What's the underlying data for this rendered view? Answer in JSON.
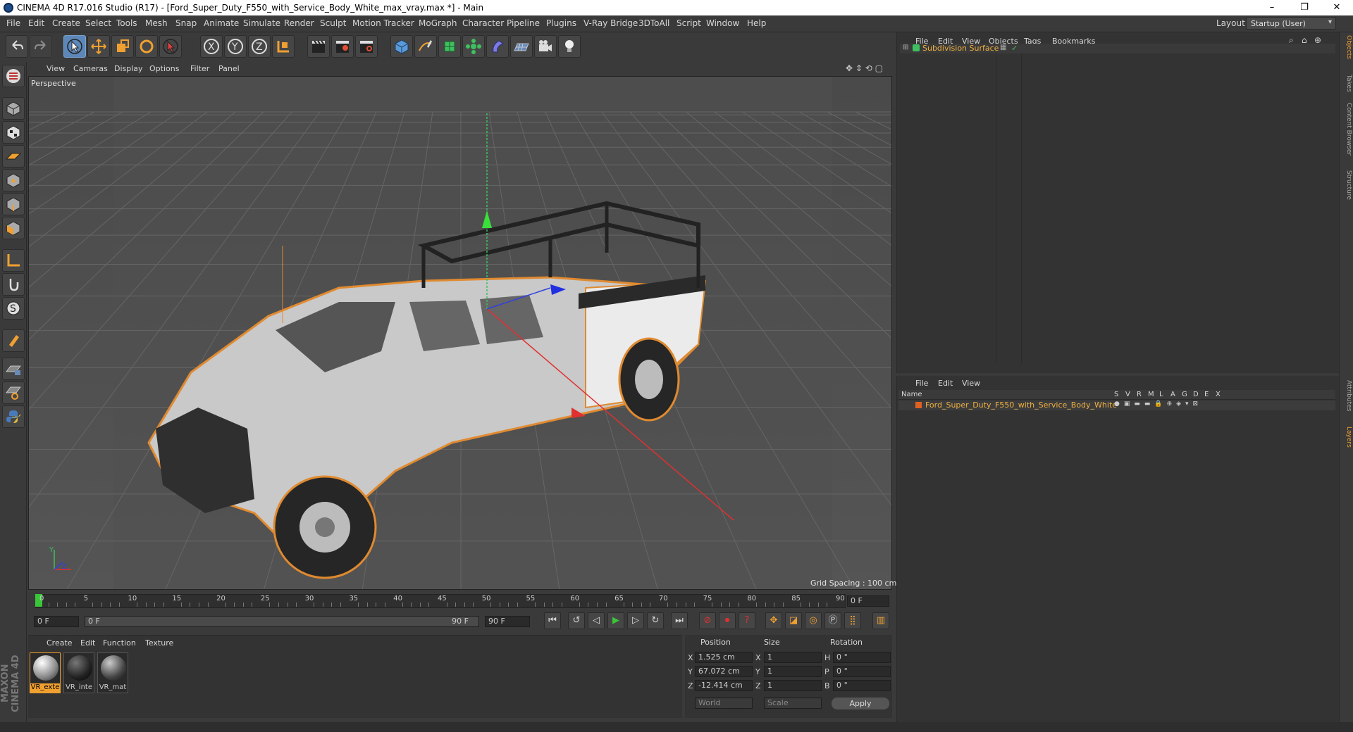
{
  "window": {
    "title": "CINEMA 4D R17.016 Studio (R17) - [Ford_Super_Duty_F550_with_Service_Body_White_max_vray.max *] - Main",
    "minimize": "–",
    "restore": "❐",
    "close": "✕"
  },
  "menubar": {
    "items": [
      "File",
      "Edit",
      "Create",
      "Select",
      "Tools",
      "Mesh",
      "Snap",
      "Animate",
      "Simulate",
      "Render",
      "Sculpt",
      "Motion Tracker",
      "MoGraph",
      "Character",
      "Pipeline",
      "Plugins",
      "V-Ray Bridge",
      "3DToAll",
      "Script",
      "Window",
      "Help"
    ],
    "layout_label": "Layout:",
    "layout_value": "Startup (User)"
  },
  "viewport": {
    "menu": [
      "View",
      "Cameras",
      "Display",
      "Options",
      "Filter",
      "Panel"
    ],
    "camera_label": "Perspective",
    "grid_spacing": "Grid Spacing : 100 cm",
    "axis_y": "Y",
    "axis_z": "Z"
  },
  "timeline": {
    "ticks": [
      "0",
      "5",
      "10",
      "15",
      "20",
      "25",
      "30",
      "35",
      "40",
      "45",
      "50",
      "55",
      "60",
      "65",
      "70",
      "75",
      "80",
      "85",
      "90"
    ],
    "frame_end_field": "0 F",
    "current_frame": "0 F",
    "range_start": "0 F",
    "range_end_inner": "90 F",
    "range_end": "90 F"
  },
  "materials": {
    "menu": [
      "Create",
      "Edit",
      "Function",
      "Texture"
    ],
    "items": [
      "VR_exte",
      "VR_inte",
      "VR_mat"
    ]
  },
  "coords": {
    "headers": [
      "Position",
      "Size",
      "Rotation"
    ],
    "rows": [
      {
        "axis": "X",
        "pos": "1.525 cm",
        "saxis": "X",
        "size": "1",
        "raxis": "H",
        "rot": "0 °"
      },
      {
        "axis": "Y",
        "pos": "67.072 cm",
        "saxis": "Y",
        "size": "1",
        "raxis": "P",
        "rot": "0 °"
      },
      {
        "axis": "Z",
        "pos": "-12.414 cm",
        "saxis": "Z",
        "size": "1",
        "raxis": "B",
        "rot": "0 °"
      }
    ],
    "mode": "World",
    "scale": "Scale",
    "apply": "Apply"
  },
  "objects": {
    "menu": [
      "File",
      "Edit",
      "View",
      "Objects",
      "Tags",
      "Bookmarks"
    ],
    "item": "Subdivision Surface"
  },
  "layers": {
    "menu": [
      "File",
      "Edit",
      "View"
    ],
    "name_header": "Name",
    "columns": [
      "S",
      "V",
      "R",
      "M",
      "L",
      "A",
      "G",
      "D",
      "E",
      "X"
    ],
    "item": "Ford_Super_Duty_F550_with_Service_Body_White"
  },
  "side_tabs": [
    "Objects",
    "Takes",
    "Content Browser",
    "Structure",
    "Attributes",
    "Layers"
  ],
  "brand": "MAXON CINEMA 4D",
  "colors": {
    "accent_orange": "#f0a030",
    "selected_blue": "#5c87b8",
    "play_green": "#39c639"
  }
}
